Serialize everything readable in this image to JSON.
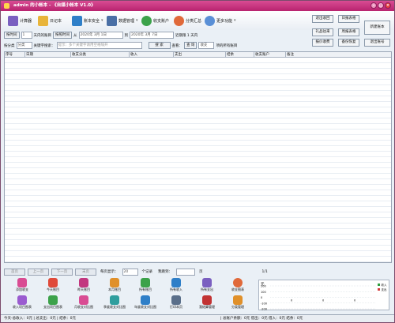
{
  "window": {
    "title": "admin 的小帐本 - 《自媒小帐本 V1.0》"
  },
  "toolbar": {
    "calc": "计算器",
    "notes": "日记本",
    "account_safe": "账本安全",
    "data_mgmt": "数据管理",
    "my_accounts": "收支账户",
    "classify": "分类汇总",
    "more": "更多功能"
  },
  "right_buttons": {
    "mark_recycle": "退出收回",
    "income_stats": "日报表格",
    "receive_goods": "礼品往来",
    "week_report": "周报表格",
    "fee_stats": "报价收费",
    "month_report": "月报表格",
    "year_report": "年度报表",
    "backup": "备份恢复",
    "lock": "退出账号",
    "new_account": "新建账本"
  },
  "filter": {
    "date_label": "按时间",
    "date_mode": "最近",
    "days": "1",
    "unit": "天内的账目",
    "time_range": "按照时间",
    "from_label": "从",
    "from_date": "2020年 3月 1日",
    "to_label": "到",
    "to_date": "2020年 3月 7日",
    "fixed_range": "近期限 1 天内",
    "classify_label": "按分类",
    "classify_value": "分类",
    "kw_label": "关键字搜索：",
    "kw_placeholder": "提示：多个关键字请用空格隔开",
    "search": "搜 索",
    "query": "查 询",
    "view_label": "查看：",
    "view_value": "收支",
    "suffix": "项的所有账目"
  },
  "grid": {
    "headers": [
      "序号",
      "日期",
      "收支分类",
      "收入",
      "支出",
      "结余",
      "收支账户",
      "备注"
    ]
  },
  "pager": {
    "first": "首页",
    "prev": "上一页",
    "next": "下一页",
    "last": "末页",
    "per_page_label": "每页显示：",
    "per_page": "20",
    "records": "个记录",
    "jump_label": "我跳到：",
    "page_unit": "页",
    "page_info": "1/1"
  },
  "bottom": {
    "items": [
      "添加收支",
      "今天账目",
      "昨天账目",
      "本月账目",
      "所有账目",
      "所有收入",
      "所有支出",
      "收支图表",
      "收入项目图表",
      "支出项目图表",
      "月收支对比图",
      "季度收支对比图",
      "年度收支对比图",
      "打印本页",
      "我结算管理",
      "分类管理"
    ]
  },
  "chart_data": {
    "type": "line",
    "ylabel": "元",
    "y_ticks": [
      "200",
      "100",
      "0",
      "-100",
      "-200"
    ],
    "series": [
      {
        "name": "收入",
        "color": "#2e9e3e"
      },
      {
        "name": "支出",
        "color": "#d33b3b"
      }
    ],
    "values": [
      "0",
      "0",
      "0"
    ]
  },
  "status": {
    "left": "今天-总收入：0元 | 总支出：0元 | 结余：0元",
    "right": "| 总账户余额：0元 借出：0元 借入：0元 结余：0元"
  },
  "colors": {
    "title": "#c2377f",
    "bg": "#eaf0f6",
    "border": "#9aa5b5"
  }
}
